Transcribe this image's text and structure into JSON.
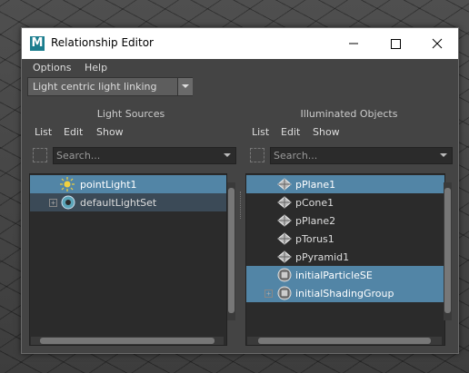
{
  "window": {
    "title": "Relationship Editor",
    "logo_letter": "M",
    "menu": [
      "Options",
      "Help"
    ],
    "mode_dropdown": "Light centric light linking"
  },
  "left_panel": {
    "title": "Light Sources",
    "menu": [
      "List",
      "Edit",
      "Show"
    ],
    "search_placeholder": "Search...",
    "items": [
      {
        "label": "pointLight1",
        "icon": "point-light-icon",
        "selected": true
      },
      {
        "label": "defaultLightSet",
        "icon": "light-set-icon",
        "selected": false,
        "expandable": true
      }
    ]
  },
  "right_panel": {
    "title": "Illuminated Objects",
    "menu": [
      "List",
      "Edit",
      "Show"
    ],
    "search_placeholder": "Search...",
    "items": [
      {
        "label": "pPlane1",
        "icon": "mesh-icon",
        "selected": true
      },
      {
        "label": "pCone1",
        "icon": "mesh-icon",
        "selected": false
      },
      {
        "label": "pPlane2",
        "icon": "mesh-icon",
        "selected": false
      },
      {
        "label": "pTorus1",
        "icon": "mesh-icon",
        "selected": false
      },
      {
        "label": "pPyramid1",
        "icon": "mesh-icon",
        "selected": false
      },
      {
        "label": "initialParticleSE",
        "icon": "shading-group-icon",
        "selected": true
      },
      {
        "label": "initialShadingGroup",
        "icon": "shading-group-icon",
        "selected": true,
        "expandable": true
      }
    ]
  },
  "colors": {
    "selection": "#5285a6",
    "panel_bg": "#444444",
    "list_bg": "#2b2b2b"
  }
}
